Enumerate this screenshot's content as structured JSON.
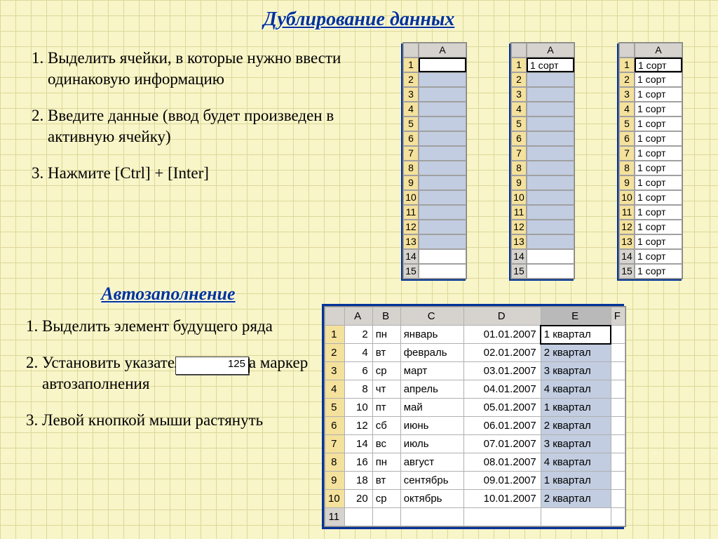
{
  "heading1": "Дублирование данных",
  "heading2": "Автозаполнение ",
  "list1": {
    "i1": "Выделить ячейки, в которые нужно ввести одинаковую информацию",
    "i2": "Введите данные (ввод будет произведен в активную ячейку)",
    "i3": "Нажмите [Ctrl] + [Inter]"
  },
  "list2": {
    "i1": "Выделить элемент будущего ряда",
    "i2": "Установить указатель мыши на маркер автозаполнения",
    "i3": "Левой кнопкой мыши растянуть"
  },
  "sample_input": "125",
  "mini": {
    "colhead": "A",
    "rows": 15,
    "sheet2_cell": "1 сорт",
    "sheet3_cell": "1 сорт"
  },
  "big": {
    "cols": [
      "A",
      "B",
      "C",
      "D",
      "E",
      "F"
    ],
    "rows": [
      {
        "n": "1",
        "a": "2",
        "b": "пн",
        "c": "январь",
        "d": "01.01.2007",
        "e": "1 квартал"
      },
      {
        "n": "2",
        "a": "4",
        "b": "вт",
        "c": "февраль",
        "d": "02.01.2007",
        "e": "2 квартал"
      },
      {
        "n": "3",
        "a": "6",
        "b": "ср",
        "c": "март",
        "d": "03.01.2007",
        "e": "3 квартал"
      },
      {
        "n": "4",
        "a": "8",
        "b": "чт",
        "c": "апрель",
        "d": "04.01.2007",
        "e": "4 квартал"
      },
      {
        "n": "5",
        "a": "10",
        "b": "пт",
        "c": "май",
        "d": "05.01.2007",
        "e": "1 квартал"
      },
      {
        "n": "6",
        "a": "12",
        "b": "сб",
        "c": "июнь",
        "d": "06.01.2007",
        "e": "2 квартал"
      },
      {
        "n": "7",
        "a": "14",
        "b": "вс",
        "c": "июль",
        "d": "07.01.2007",
        "e": "3 квартал"
      },
      {
        "n": "8",
        "a": "16",
        "b": "пн",
        "c": "август",
        "d": "08.01.2007",
        "e": "4 квартал"
      },
      {
        "n": "9",
        "a": "18",
        "b": "вт",
        "c": "сентябрь",
        "d": "09.01.2007",
        "e": "1 квартал"
      },
      {
        "n": "10",
        "a": "20",
        "b": "ср",
        "c": "октябрь",
        "d": "10.01.2007",
        "e": "2 квартал"
      }
    ],
    "empty_row": "11"
  }
}
